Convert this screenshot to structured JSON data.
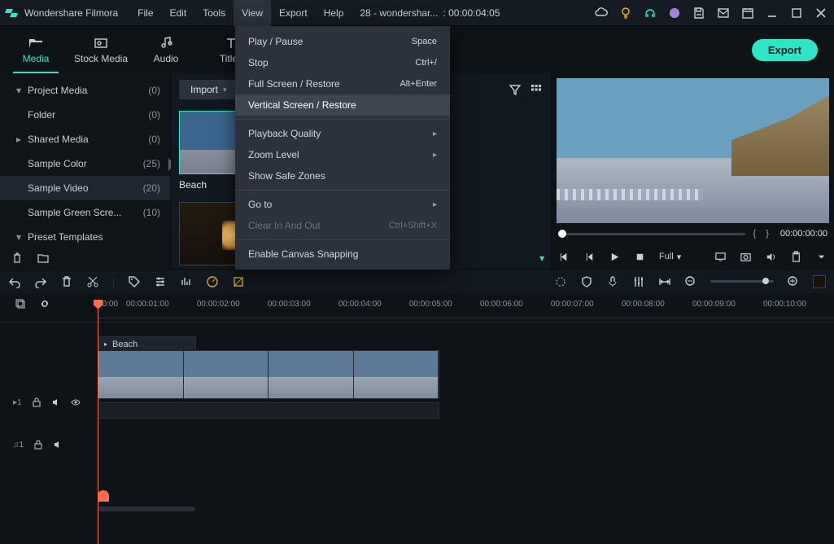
{
  "app": {
    "name": "Wondershare Filmora"
  },
  "title": {
    "project": "28 - wondershar...",
    "timecode": ": 00:00:04:05"
  },
  "menubar": [
    "File",
    "Edit",
    "Tools",
    "View",
    "Export",
    "Help"
  ],
  "module_tabs": {
    "media": "Media",
    "stock": "Stock Media",
    "audio": "Audio",
    "titles": "Titles"
  },
  "export_btn": "Export",
  "media_tree": [
    {
      "caret": "▾",
      "label": "Project Media",
      "count": "(0)"
    },
    {
      "indent": true,
      "label": "Folder",
      "count": "(0)"
    },
    {
      "caret": "▸",
      "label": "Shared Media",
      "count": "(0)"
    },
    {
      "indent": true,
      "label": "Sample Color",
      "count": "(25)"
    },
    {
      "indent": true,
      "selected": true,
      "label": "Sample Video",
      "count": "(20)"
    },
    {
      "indent": true,
      "label": "Sample Green Scre...",
      "count": "(10)"
    },
    {
      "caret": "▾",
      "label": "Preset Templates",
      "count": ""
    }
  ],
  "import": {
    "label": "Import",
    "caret": "▾"
  },
  "thumb": {
    "beach": "Beach"
  },
  "dropdown": {
    "play": "Play / Pause",
    "play_sc": "Space",
    "stop": "Stop",
    "stop_sc": "Ctrl+/",
    "full": "Full Screen / Restore",
    "full_sc": "Alt+Enter",
    "vert": "Vertical Screen / Restore",
    "pq": "Playback Quality",
    "zoom": "Zoom Level",
    "safe": "Show Safe Zones",
    "goto": "Go to",
    "clear": "Clear In And Out",
    "clear_sc": "Ctrl+Shift+X",
    "snap": "Enable Canvas Snapping",
    "sub": "▸"
  },
  "ruler": [
    "00:00",
    "00:00:01:00",
    "00:00:02:00",
    "00:00:03:00",
    "00:00:04:00",
    "00:00:05:00",
    "00:00:06:00",
    "00:00:07:00",
    "00:00:08:00",
    "00:00:09:00",
    "00:00:10:00"
  ],
  "preview": {
    "timecode": "00:00:00:00",
    "fit": "Full",
    "fit_caret": "▾",
    "mark_in": "{",
    "mark_out": "}"
  },
  "clip": {
    "name": "Beach",
    "caret": "▸"
  },
  "track_heads": {
    "v1": "▸1",
    "a1": "♫1"
  }
}
